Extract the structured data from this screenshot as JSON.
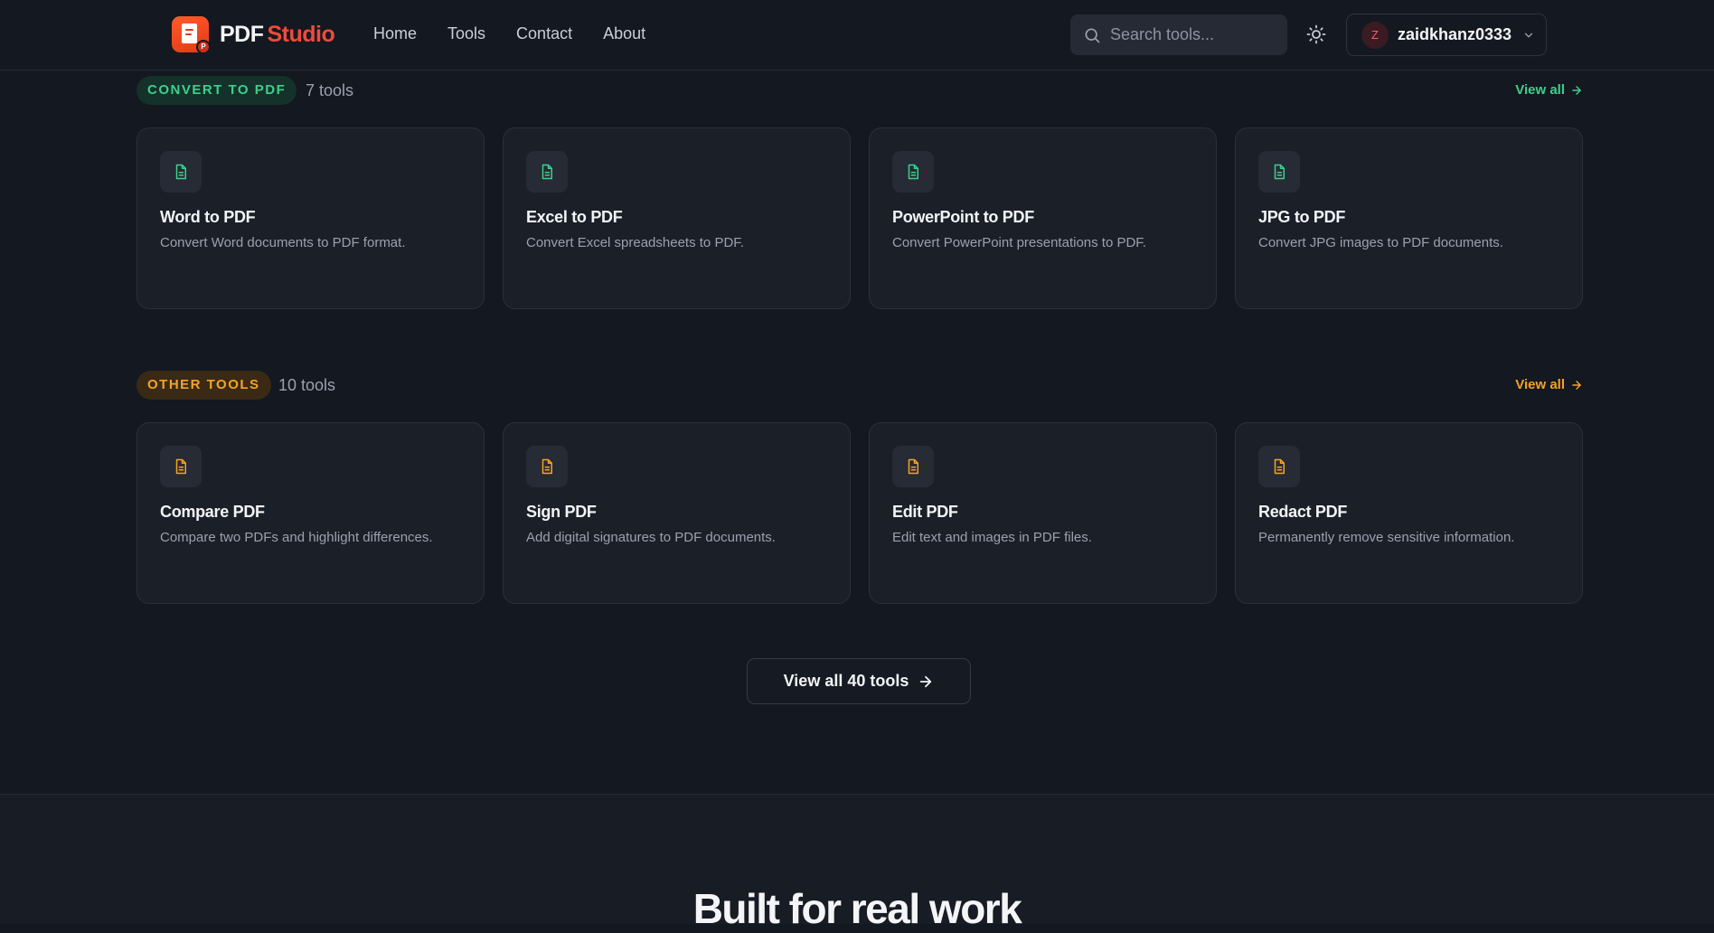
{
  "brand": {
    "name_part1": "PDF",
    "name_part2": "Studio",
    "badge": "P"
  },
  "nav": {
    "links": [
      "Home",
      "Tools",
      "Contact",
      "About"
    ]
  },
  "search": {
    "placeholder": "Search tools..."
  },
  "user": {
    "initial": "Z",
    "name": "zaidkhanz0333"
  },
  "sections": [
    {
      "label": "CONVERT TO PDF",
      "count": "7 tools",
      "view_all": "View all",
      "accent": "#3ed08b",
      "cards": [
        {
          "title": "Word to PDF",
          "desc": "Convert Word documents to PDF format.",
          "icon": "document-icon"
        },
        {
          "title": "Excel to PDF",
          "desc": "Convert Excel spreadsheets to PDF.",
          "icon": "document-icon"
        },
        {
          "title": "PowerPoint to PDF",
          "desc": "Convert PowerPoint presentations to PDF.",
          "icon": "document-icon"
        },
        {
          "title": "JPG to PDF",
          "desc": "Convert JPG images to PDF documents.",
          "icon": "document-icon"
        }
      ]
    },
    {
      "label": "OTHER TOOLS",
      "count": "10 tools",
      "view_all": "View all",
      "accent": "#f5a325",
      "cards": [
        {
          "title": "Compare PDF",
          "desc": "Compare two PDFs and highlight differences.",
          "icon": "document-icon"
        },
        {
          "title": "Sign PDF",
          "desc": "Add digital signatures to PDF documents.",
          "icon": "document-icon"
        },
        {
          "title": "Edit PDF",
          "desc": "Edit text and images in PDF files.",
          "icon": "document-icon"
        },
        {
          "title": "Redact PDF",
          "desc": "Permanently remove sensitive information.",
          "icon": "document-icon"
        }
      ]
    }
  ],
  "cta": {
    "label": "View all 40 tools"
  },
  "headline": "Built for real work"
}
